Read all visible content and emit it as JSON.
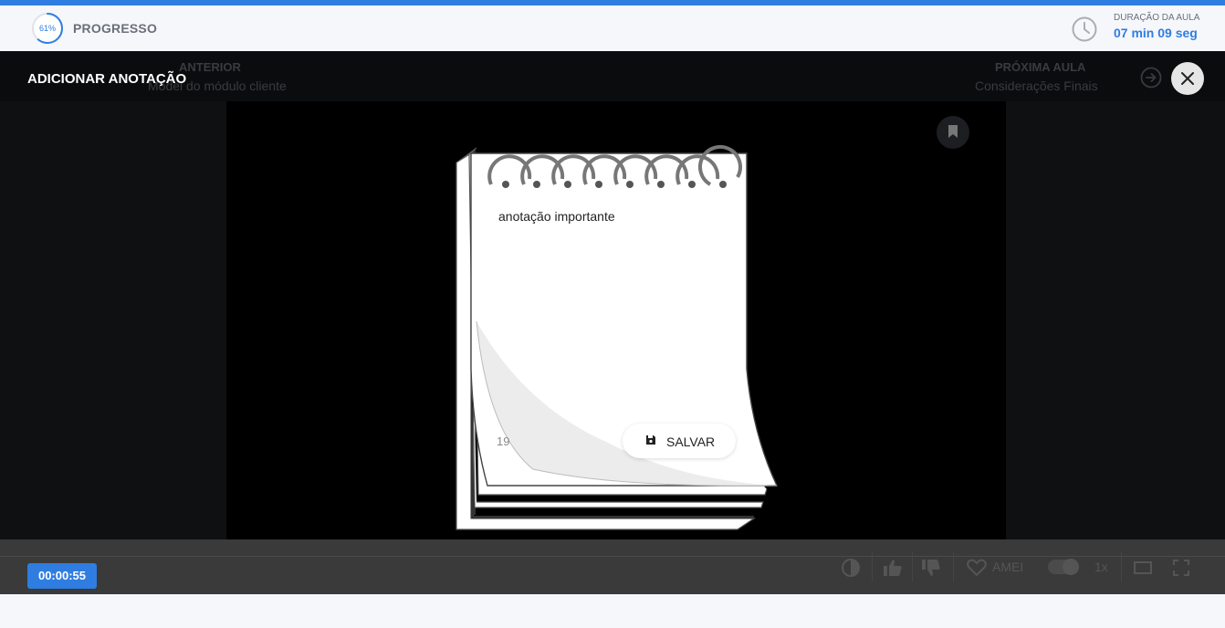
{
  "header": {
    "progress_percent": "61%",
    "progress_value": 61,
    "progress_label": "PROGRESSO",
    "duration_label": "DURAÇÃO DA AULA",
    "duration_value": "07 min 09 seg"
  },
  "navigation": {
    "prev_label": "ANTERIOR",
    "prev_title": "Model do módulo cliente",
    "next_label": "PRÓXIMA AULA",
    "next_title": "Considerações Finais"
  },
  "modal": {
    "title": "ADICIONAR ANOTAÇÃO",
    "note_text": "anotação importante",
    "char_count": "19",
    "save_label": "SALVAR"
  },
  "controls": {
    "timestamp": "00:00:55",
    "love_label": "AMEI",
    "speed_label": "1x"
  },
  "colors": {
    "accent": "#2f7de1",
    "overlay": "#000000"
  },
  "icons": [
    "clock-icon",
    "close-icon",
    "bookmark-icon",
    "save-icon",
    "arrow-right-icon",
    "contrast-icon",
    "thumbs-up-icon",
    "thumbs-down-icon",
    "heart-icon",
    "theater-icon",
    "fullscreen-icon"
  ]
}
